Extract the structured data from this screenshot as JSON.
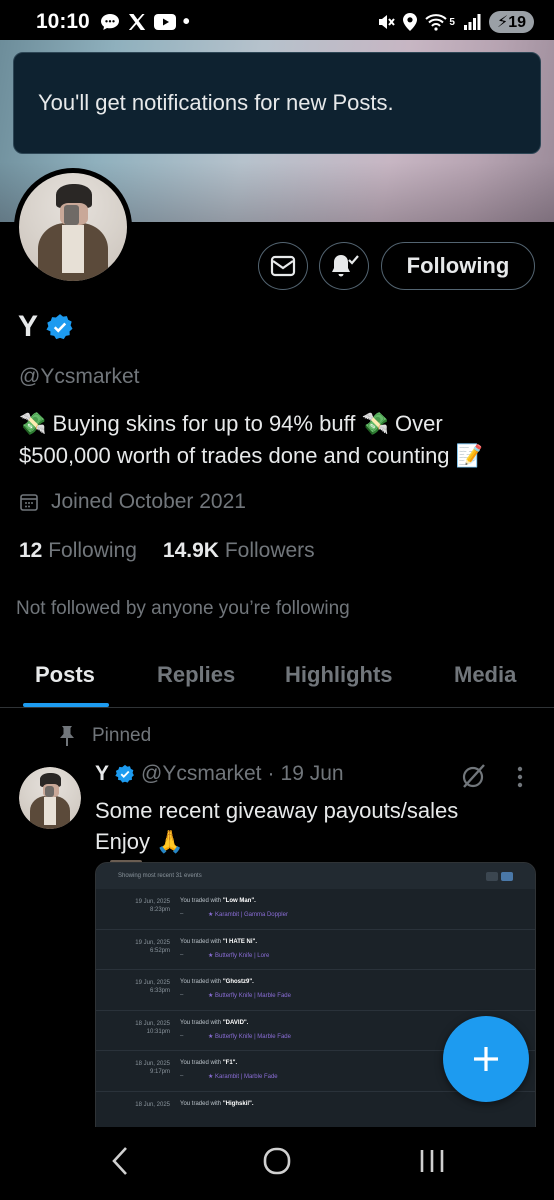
{
  "status_bar": {
    "time": "10:10",
    "left_icons": [
      "chat-bubble-icon",
      "x-logo-icon",
      "youtube-icon",
      "dot-icon"
    ],
    "right_icons": [
      "mute-icon",
      "location-icon",
      "wifi-icon",
      "signal-icon"
    ],
    "wifi_label": "5",
    "battery": "19"
  },
  "toast": {
    "message": "You'll get notifications for new Posts."
  },
  "profile": {
    "name": "Y",
    "verified": true,
    "handle": "@Ycsmarket",
    "bio": "💸 Buying skins for up to 94% buff 💸 Over $500,000 worth of trades done and counting 📝",
    "joined": "Joined October 2021",
    "following_count": "12",
    "following_label": "Following",
    "followers_count": "14.9K",
    "followers_label": "Followers",
    "not_followed": "Not followed by anyone you’re following",
    "follow_button": "Following",
    "colors": {
      "accent": "#1d9bf0",
      "muted": "#71767b",
      "text": "#e7e9ea",
      "bg": "#000000"
    }
  },
  "tabs": [
    {
      "label": "Posts",
      "active": true
    },
    {
      "label": "Replies",
      "active": false
    },
    {
      "label": "Highlights",
      "active": false
    },
    {
      "label": "Media",
      "active": false
    }
  ],
  "pinned_post": {
    "pinned_label": "Pinned",
    "author_name": "Y",
    "author_handle": "@Ycsmarket",
    "separator": "·",
    "date": "19 Jun",
    "text_line1": "Some recent giveaway payouts/sales",
    "text_line2": "Enjoy 🙏",
    "embed": {
      "header": "Showing most recent 31 events",
      "rows": [
        {
          "date": "19 Jun, 2025",
          "time": "8:23pm",
          "prefix": "You traded with",
          "partner": "\"Low Man\".",
          "item": "★ Karambit | Gamma Doppler"
        },
        {
          "date": "19 Jun, 2025",
          "time": "6:52pm",
          "prefix": "You traded with",
          "partner": "\"I HATE Ni\".",
          "item": "★ Butterfly Knife | Lore"
        },
        {
          "date": "19 Jun, 2025",
          "time": "6:33pm",
          "prefix": "You traded with",
          "partner": "\"Ghostz9\".",
          "item": "★ Butterfly Knife | Marble Fade"
        },
        {
          "date": "18 Jun, 2025",
          "time": "10:31pm",
          "prefix": "You traded with",
          "partner": "\"DAVID\".",
          "item": "★ Butterfly Knife | Marble Fade"
        },
        {
          "date": "18 Jun, 2025",
          "time": "9:17pm",
          "prefix": "You traded with",
          "partner": "\"F1\".",
          "item": "★ Karambit | Marble Fade"
        },
        {
          "date": "18 Jun, 2025",
          "time": "",
          "prefix": "You traded with",
          "partner": "\"Highskil\".",
          "item": ""
        }
      ]
    }
  }
}
